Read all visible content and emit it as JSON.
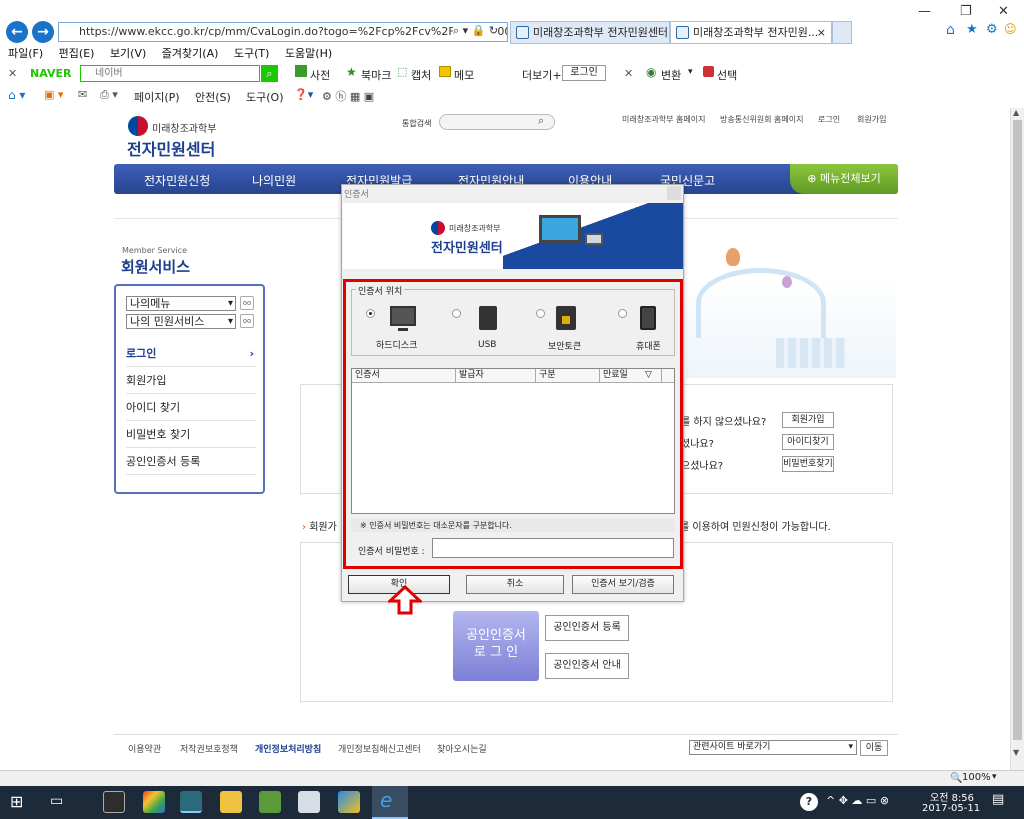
{
  "browser": {
    "url": "https://www.ekcc.go.kr/cp/mm/CvaLogin.do?togo=%2Fcp%2Fcv%2FCp1440000_0079",
    "tabs": [
      {
        "title": "미래창조과학부 전자민원센터..."
      },
      {
        "title": "미래창조과학부 전자민원...",
        "close": "×"
      }
    ],
    "menu": [
      "파일(F)",
      "편집(E)",
      "보기(V)",
      "즐겨찾기(A)",
      "도구(T)",
      "도움말(H)"
    ],
    "naver": {
      "brand": "NAVER",
      "placeholder": "네이버",
      "items": [
        "사전",
        "북마크",
        "캡처",
        "메모"
      ],
      "more": "더보기+",
      "login": "로그인",
      "convert": "변환",
      "select": "선택"
    },
    "cmd": [
      "페이지(P)",
      "안전(S)",
      "도구(O)"
    ],
    "zoom": "100%"
  },
  "site": {
    "ministry": "미래창조과학부",
    "center": "전자민원센터",
    "search_label": "통합검색",
    "top_links": [
      "미래창조과학부 홈페이지",
      "방송통신위원회 홈페이지",
      "로그인",
      "회원가입"
    ],
    "nav": [
      "전자민원신청",
      "나의민원",
      "전자민원발급",
      "전자민원안내",
      "이용안내",
      "국민신문고"
    ],
    "menu_all": "메뉴전체보기",
    "section_en": "Member Service",
    "section_kr": "회원서비스",
    "select1": "나의메뉴",
    "select2": "나의 민원서비스",
    "side_items": [
      "로그인",
      "회원가입",
      "아이디 찾기",
      "비밀번호 찾기",
      "공인인증서 등록"
    ],
    "q1": "를 하지 않으셨나요?",
    "q2": "셨나요?",
    "q3": "으셨나요?",
    "btn1": "회원가입",
    "btn2": "아이디찾기",
    "btn3": "비밀번호찾기",
    "notice_left": "회원가",
    "notice_right": "를 이용하여 민원신청이 가능합니다.",
    "cert_login_1": "공인인증서",
    "cert_login_2": "로 그 인",
    "cert_register": "공인인증서 등록",
    "cert_guide": "공인인증서 안내",
    "footer": [
      "이용약관",
      "저작권보호정책",
      "개인정보처리방침",
      "개인정보침해신고센터",
      "찾아오시는길"
    ],
    "related": "관련사이트 바로가기",
    "go": "이동"
  },
  "dialog": {
    "title": "인증서",
    "location_label": "인증서 위치",
    "devices": [
      "하드디스크",
      "USB",
      "보안토큰",
      "휴대폰"
    ],
    "columns": [
      "인증서",
      "발급자",
      "구분",
      "만료일"
    ],
    "case_note": "※ 인증서 비밀번호는 대소문자를 구분합니다.",
    "password_label": "인증서 비밀번호 :",
    "ok": "확인",
    "cancel": "취소",
    "view": "인증서 보기/검증"
  },
  "taskbar": {
    "time": "오전 8:56",
    "date": "2017-05-11"
  }
}
